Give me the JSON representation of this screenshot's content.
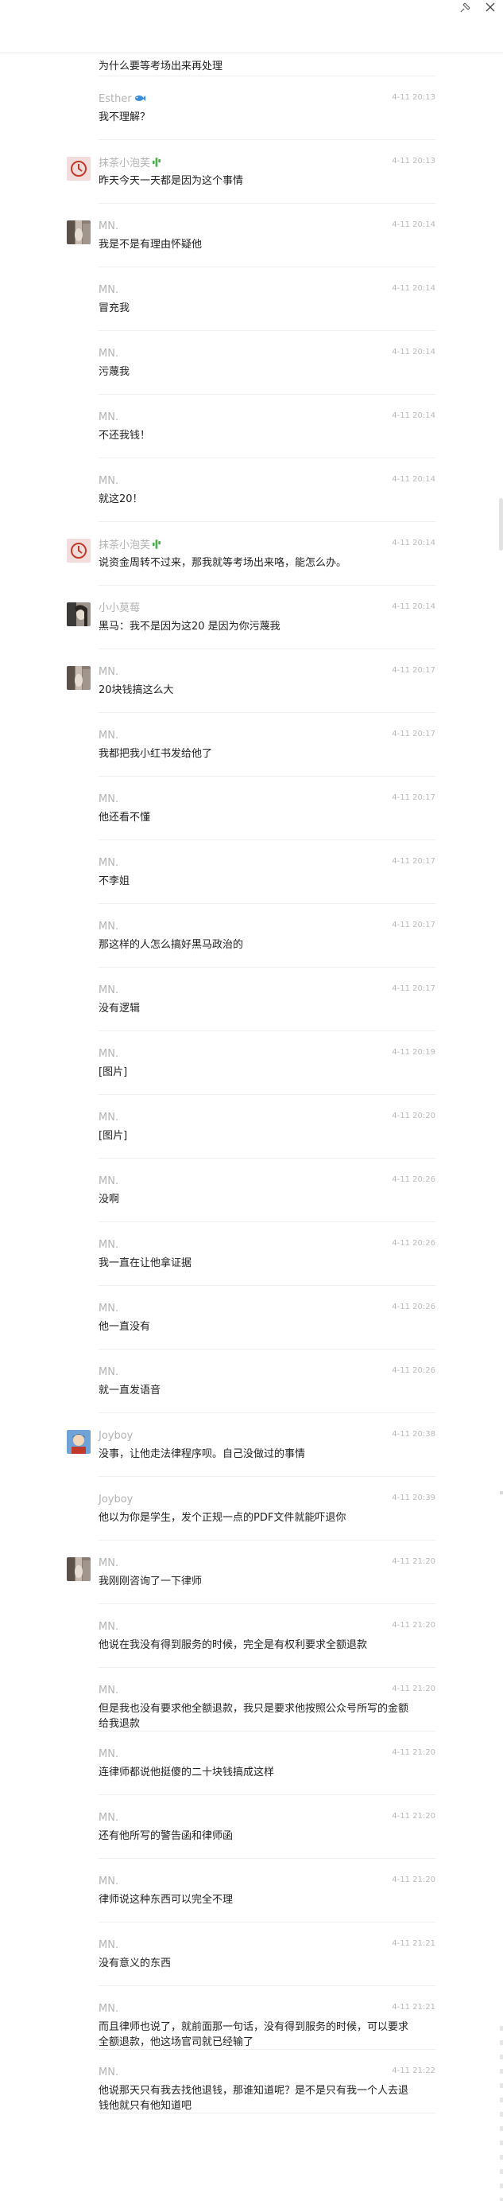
{
  "window": {
    "pin_icon": "pin-icon",
    "close_icon": "close-icon"
  },
  "colors": {
    "name": "#b3b3b3",
    "time": "#b9b9b9",
    "text": "#222222",
    "divider": "#efefef",
    "leaf_icon": "#4caf50"
  },
  "messages": [
    {
      "name": "",
      "time": "",
      "text": "为什么要等考场出来再处理",
      "avatar": "mn",
      "avatar_partial": true
    },
    {
      "name": "Esther",
      "name_icon": "fish-emoji",
      "time": "4-11 20:13",
      "text": "我不理解？",
      "avatar": ""
    },
    {
      "name": "抹茶小泡芙",
      "name_icon": "cactus-emoji",
      "time": "4-11 20:13",
      "text": "昨天今天一天都是因为这个事情",
      "avatar": "matcha"
    },
    {
      "name": "MN.",
      "time": "4-11 20:14",
      "text": "我是不是有理由怀疑他",
      "avatar": "mn"
    },
    {
      "name": "MN.",
      "time": "4-11 20:14",
      "text": "冒充我",
      "avatar": ""
    },
    {
      "name": "MN.",
      "time": "4-11 20:14",
      "text": "污蔑我",
      "avatar": ""
    },
    {
      "name": "MN.",
      "time": "4-11 20:14",
      "text": "不还我钱！",
      "avatar": ""
    },
    {
      "name": "MN.",
      "time": "4-11 20:14",
      "text": "就这20！",
      "avatar": ""
    },
    {
      "name": "抹茶小泡芙",
      "name_icon": "cactus-emoji",
      "time": "4-11 20:14",
      "text": "说资金周转不过来，那我就等考场出来咯，能怎么办。",
      "avatar": "matcha"
    },
    {
      "name": "小小莫莓",
      "time": "4-11 20:14",
      "text": "黑马：我不是因为这20 是因为你污蔑我",
      "avatar": "girl"
    },
    {
      "name": "MN.",
      "time": "4-11 20:17",
      "text": "20块钱搞这么大",
      "avatar": "mn"
    },
    {
      "name": "MN.",
      "time": "4-11 20:17",
      "text": "我都把我小红书发给他了",
      "avatar": ""
    },
    {
      "name": "MN.",
      "time": "4-11 20:17",
      "text": "他还看不懂",
      "avatar": ""
    },
    {
      "name": "MN.",
      "time": "4-11 20:17",
      "text": "不李姐",
      "avatar": ""
    },
    {
      "name": "MN.",
      "time": "4-11 20:17",
      "text": "那这样的人怎么搞好黑马政治的",
      "avatar": ""
    },
    {
      "name": "MN.",
      "time": "4-11 20:17",
      "text": "没有逻辑",
      "avatar": ""
    },
    {
      "name": "MN.",
      "time": "4-11 20:19",
      "text": "[图片]",
      "avatar": ""
    },
    {
      "name": "MN.",
      "time": "4-11 20:20",
      "text": "[图片]",
      "avatar": ""
    },
    {
      "name": "MN.",
      "time": "4-11 20:26",
      "text": "没啊",
      "avatar": ""
    },
    {
      "name": "MN.",
      "time": "4-11 20:26",
      "text": "我一直在让他拿证据",
      "avatar": ""
    },
    {
      "name": "MN.",
      "time": "4-11 20:26",
      "text": "他一直没有",
      "avatar": ""
    },
    {
      "name": "MN.",
      "time": "4-11 20:26",
      "text": "就一直发语音",
      "avatar": ""
    },
    {
      "name": "Joyboy",
      "time": "4-11 20:38",
      "text": "没事，让他走法律程序呗。自己没做过的事情",
      "avatar": "joyboy"
    },
    {
      "name": "Joyboy",
      "time": "4-11 20:39",
      "text": "他以为你是学生，发个正规一点的PDF文件就能吓退你",
      "avatar": ""
    },
    {
      "name": "MN.",
      "time": "4-11 21:20",
      "text": "我刚刚咨询了一下律师",
      "avatar": "mn"
    },
    {
      "name": "MN.",
      "time": "4-11 21:20",
      "text": "他说在我没有得到服务的时候，完全是有权利要求全额退款",
      "avatar": ""
    },
    {
      "name": "MN.",
      "time": "4-11 21:20",
      "text": "但是我也没有要求他全额退款，我只是要求他按照公众号所写的金额给我退款",
      "avatar": ""
    },
    {
      "name": "MN.",
      "time": "4-11 21:20",
      "text": "连律师都说他挺傻的二十块钱搞成这样",
      "avatar": ""
    },
    {
      "name": "MN.",
      "time": "4-11 21:20",
      "text": "还有他所写的警告函和律师函",
      "avatar": ""
    },
    {
      "name": "MN.",
      "time": "4-11 21:20",
      "text": "律师说这种东西可以完全不理",
      "avatar": ""
    },
    {
      "name": "MN.",
      "time": "4-11 21:21",
      "text": "没有意义的东西",
      "avatar": ""
    },
    {
      "name": "MN.",
      "time": "4-11 21:21",
      "text": "而且律师也说了，就前面那一句话，没有得到服务的时候，可以要求全额退款，他这场官司就已经输了",
      "avatar": ""
    },
    {
      "name": "MN.",
      "time": "4-11 21:22",
      "text": "他说那天只有我去找他退钱，那谁知道呢？是不是只有我一个人去退钱他就只有他知道吧",
      "avatar": ""
    }
  ]
}
